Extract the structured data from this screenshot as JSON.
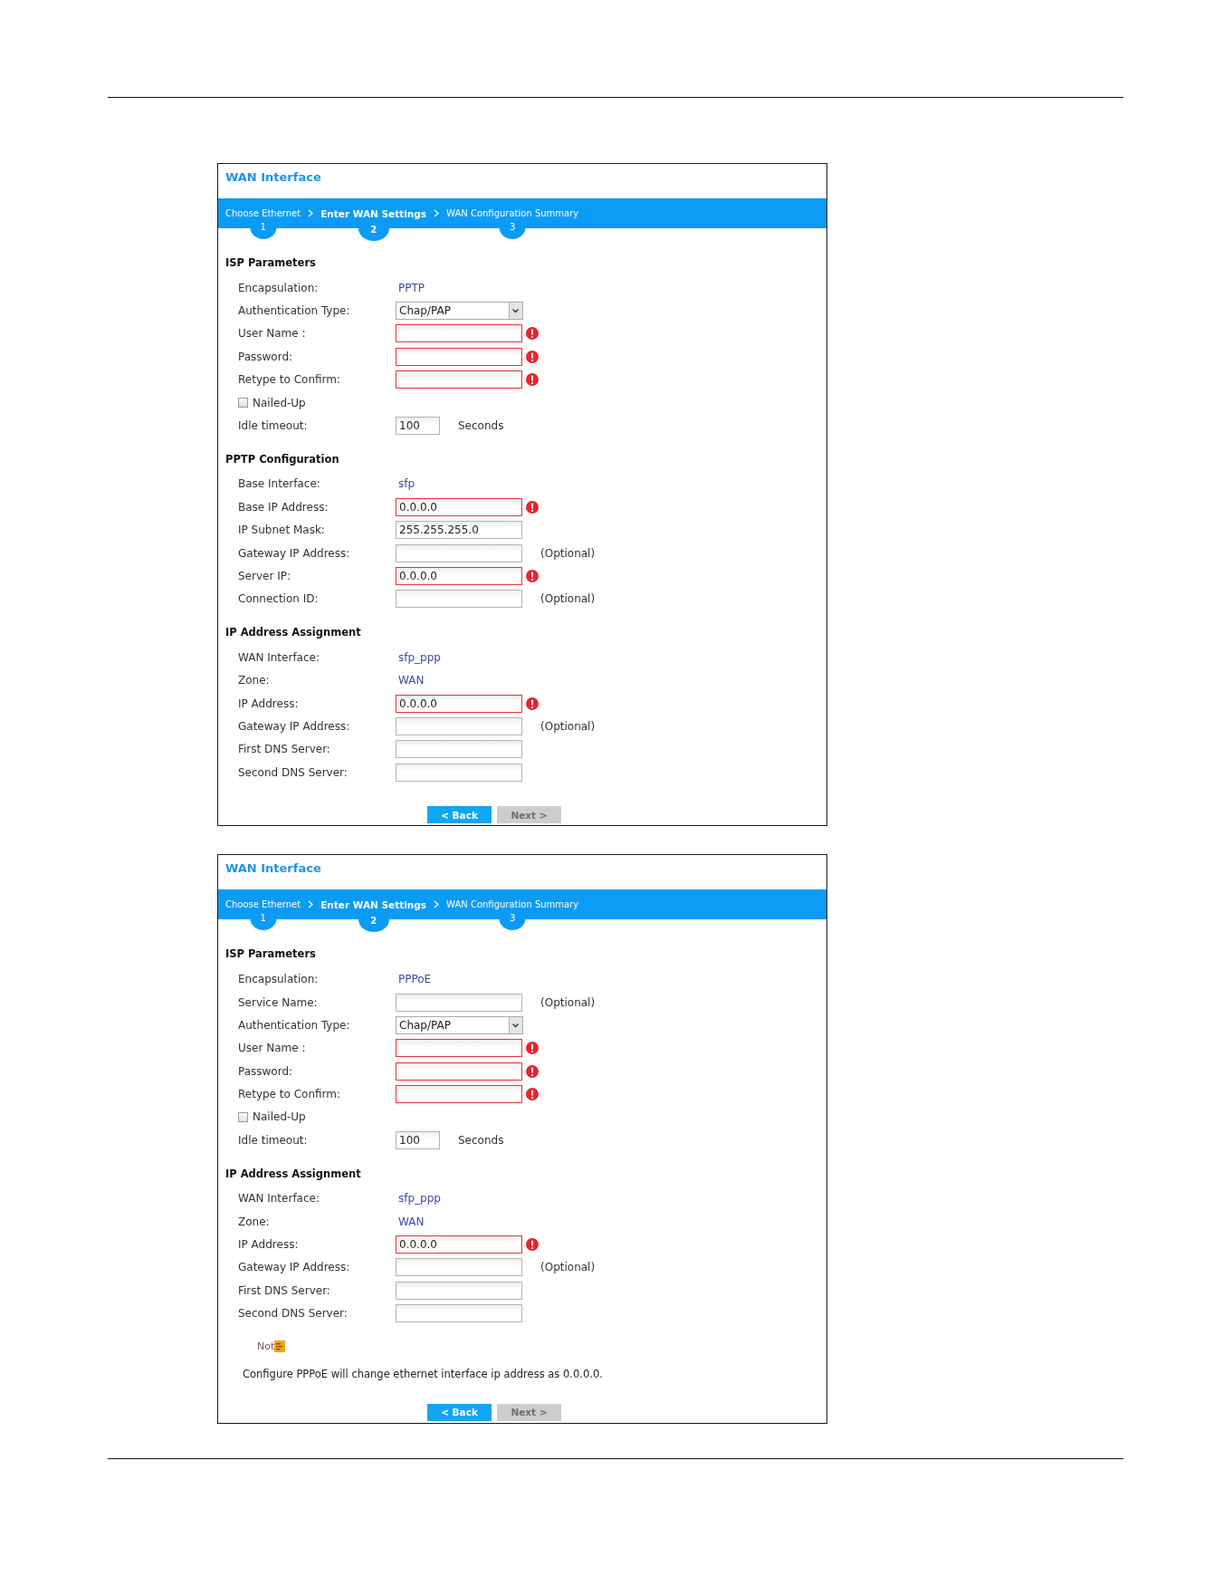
{
  "panels": [
    {
      "title": "WAN Interface",
      "steps": [
        {
          "label": "Choose Ethernet",
          "number": "1",
          "selected": false
        },
        {
          "label": "Enter WAN Settings",
          "number": "2",
          "selected": true
        },
        {
          "label": "WAN Configuration Summary",
          "number": "3",
          "selected": false
        }
      ],
      "sections": [
        {
          "heading": "ISP Parameters",
          "fields": [
            {
              "kind": "text",
              "label": "Encapsulation:",
              "value": "PPTP"
            },
            {
              "kind": "select",
              "label": "Authentication Type:",
              "value": "Chap/PAP"
            },
            {
              "kind": "input",
              "label": "User Name :",
              "invalid": true
            },
            {
              "kind": "input",
              "label": "Password:",
              "invalid": true
            },
            {
              "kind": "input",
              "label": "Retype to Confirm:",
              "invalid": true
            },
            {
              "kind": "checkbox",
              "label": "Nailed-Up",
              "checked": false
            },
            {
              "kind": "number",
              "label": "Idle timeout:",
              "value": "100",
              "invalid": false,
              "suffix": "Seconds"
            }
          ]
        },
        {
          "heading": "PPTP Configuration",
          "fields": [
            {
              "kind": "text",
              "label": "Base Interface:",
              "value": "sfp"
            },
            {
              "kind": "input",
              "label": "Base IP Address:",
              "value": "0.0.0.0",
              "invalid": true
            },
            {
              "kind": "input",
              "label": "IP Subnet Mask:",
              "value": "255.255.255.0",
              "invalid": false
            },
            {
              "kind": "input",
              "label": "Gateway IP Address:",
              "invalid": false,
              "suffix": "(Optional)"
            },
            {
              "kind": "input",
              "label": "Server IP:",
              "value": "0.0.0.0",
              "invalid": true
            },
            {
              "kind": "input",
              "label": "Connection ID:",
              "invalid": false,
              "suffix": "(Optional)"
            }
          ]
        },
        {
          "heading": "IP Address Assignment",
          "fields": [
            {
              "kind": "text",
              "label": "WAN Interface:",
              "value": "sfp_ppp"
            },
            {
              "kind": "text",
              "label": "Zone:",
              "value": "WAN"
            },
            {
              "kind": "input",
              "label": "IP Address:",
              "value": "0.0.0.0",
              "invalid": true
            },
            {
              "kind": "input",
              "label": "Gateway IP Address:",
              "invalid": false,
              "suffix": "(Optional)"
            },
            {
              "kind": "input",
              "label": "First DNS Server:",
              "invalid": false
            },
            {
              "kind": "input",
              "label": "Second DNS Server:",
              "invalid": false
            }
          ]
        }
      ],
      "buttons": [
        {
          "label": "< Back",
          "disabled": false
        },
        {
          "label": "Next >",
          "disabled": true
        }
      ]
    },
    {
      "title": "WAN Interface",
      "steps": [
        {
          "label": "Choose Ethernet",
          "number": "1",
          "selected": false
        },
        {
          "label": "Enter WAN Settings",
          "number": "2",
          "selected": true
        },
        {
          "label": "WAN Configuration Summary",
          "number": "3",
          "selected": false
        }
      ],
      "sections": [
        {
          "heading": "ISP Parameters",
          "fields": [
            {
              "kind": "text",
              "label": "Encapsulation:",
              "value": "PPPoE"
            },
            {
              "kind": "input",
              "label": "Service Name:",
              "invalid": false,
              "suffix": "(Optional)"
            },
            {
              "kind": "select",
              "label": "Authentication Type:",
              "value": "Chap/PAP"
            },
            {
              "kind": "input",
              "label": "User Name :",
              "invalid": true
            },
            {
              "kind": "input",
              "label": "Password:",
              "invalid": true
            },
            {
              "kind": "input",
              "label": "Retype to Confirm:",
              "invalid": true
            },
            {
              "kind": "checkbox",
              "label": "Nailed-Up",
              "checked": false
            },
            {
              "kind": "number",
              "label": "Idle timeout:",
              "value": "100",
              "invalid": false,
              "suffix": "Seconds"
            }
          ]
        },
        {
          "heading": "IP Address Assignment",
          "fields": [
            {
              "kind": "text",
              "label": "WAN Interface:",
              "value": "sfp_ppp"
            },
            {
              "kind": "text",
              "label": "Zone:",
              "value": "WAN"
            },
            {
              "kind": "input",
              "label": "IP Address:",
              "value": "0.0.0.0",
              "invalid": true
            },
            {
              "kind": "input",
              "label": "Gateway IP Address:",
              "invalid": false,
              "suffix": "(Optional)"
            },
            {
              "kind": "input",
              "label": "First DNS Server:",
              "invalid": false
            },
            {
              "kind": "input",
              "label": "Second DNS Server:",
              "invalid": false
            }
          ]
        }
      ],
      "note": {
        "label": "Not",
        "text": "Configure PPPoE will change ethernet interface ip address as 0.0.0.0."
      },
      "buttons": [
        {
          "label": "< Back",
          "disabled": false
        },
        {
          "label": "Next >",
          "disabled": true
        }
      ]
    }
  ]
}
